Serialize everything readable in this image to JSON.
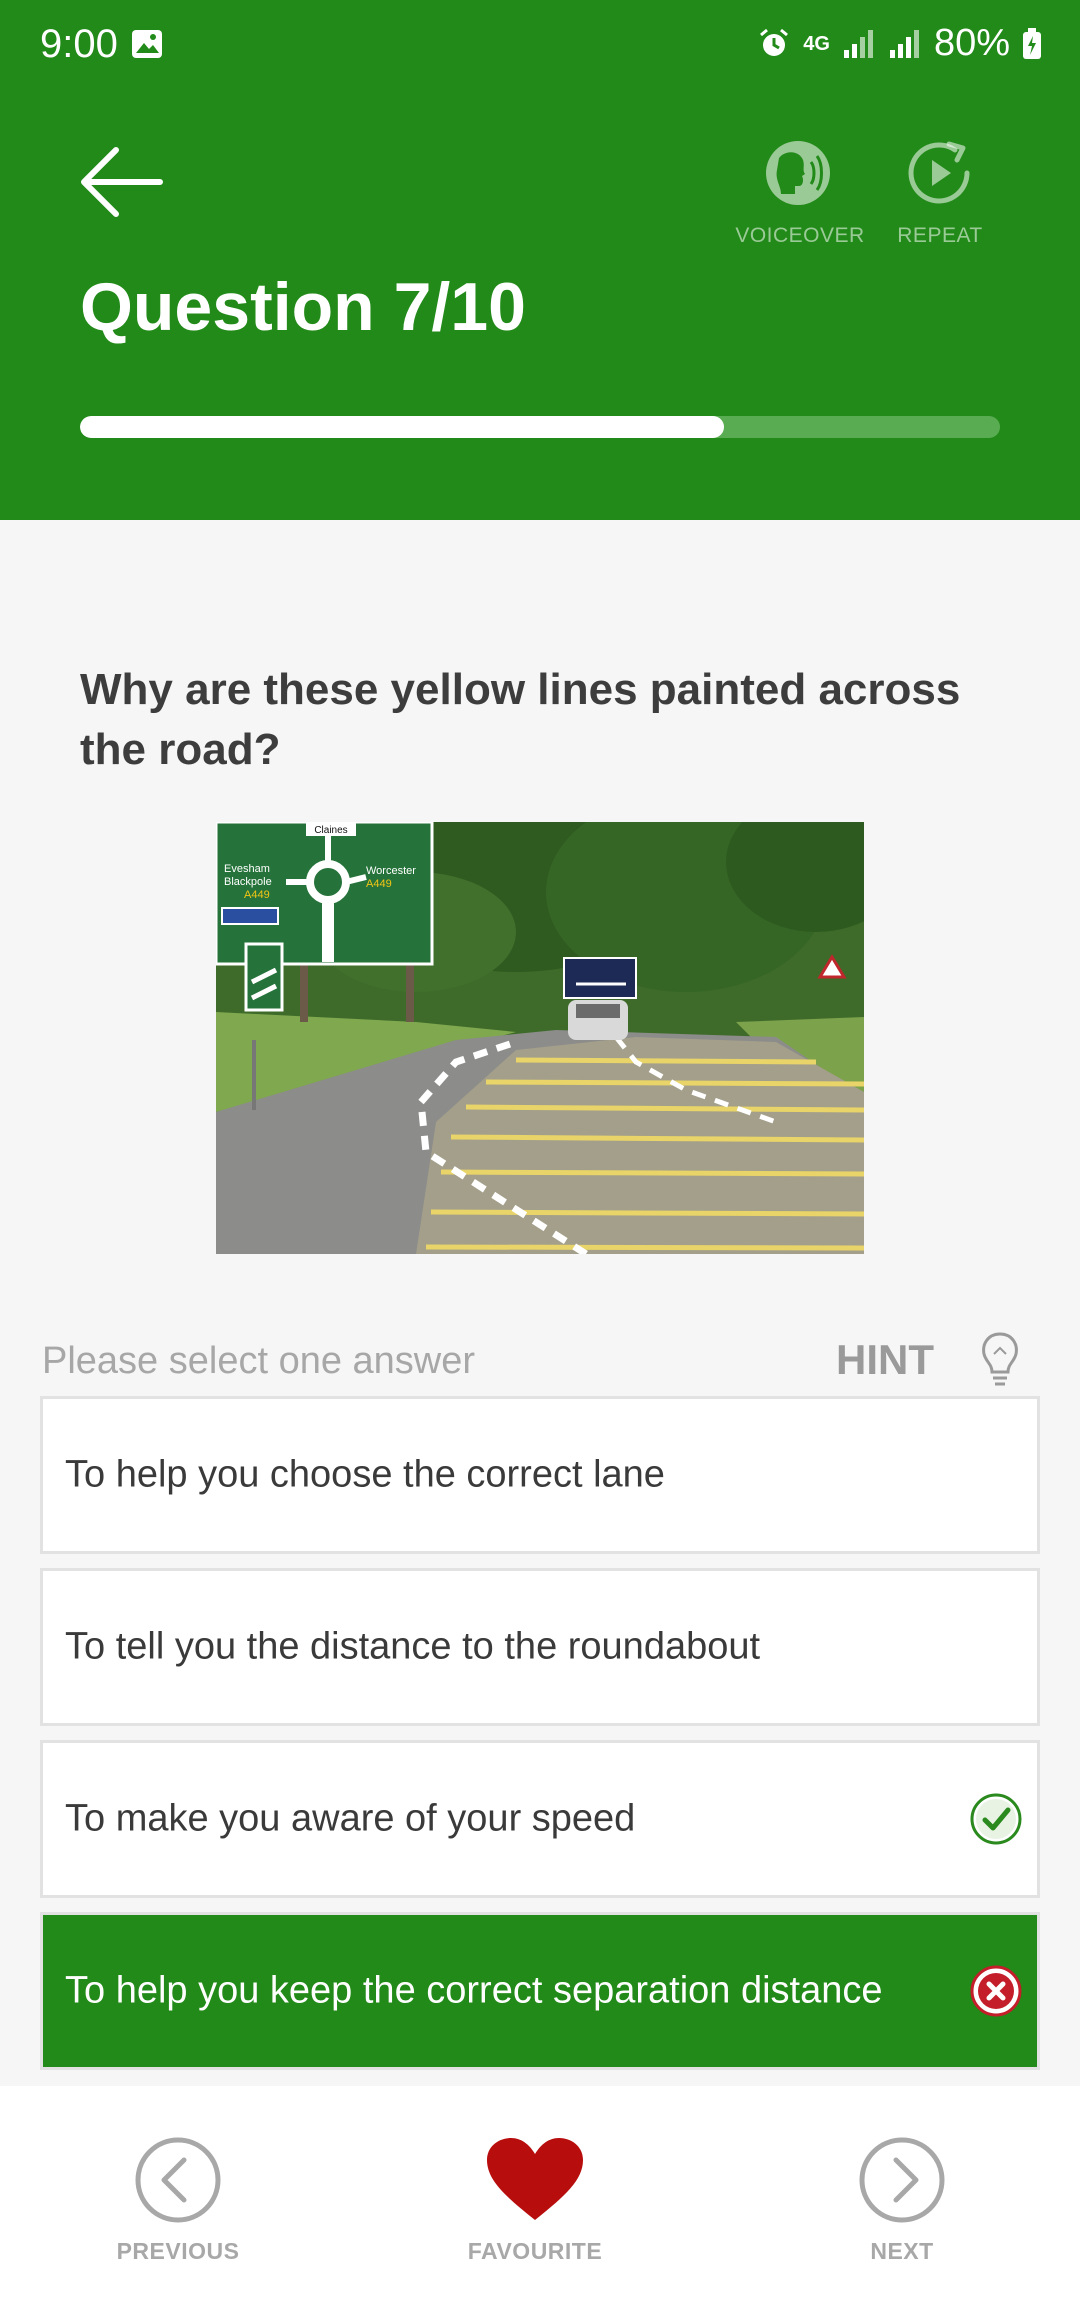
{
  "status_bar": {
    "time": "9:00",
    "network": "4G",
    "battery": "80%"
  },
  "header": {
    "title": "Question 7/10",
    "voiceover_label": "VOICEOVER",
    "repeat_label": "REPEAT",
    "progress_fraction": 0.7
  },
  "question": {
    "text": "Why are these yellow lines painted across the road?",
    "image_sign_text": {
      "top": "Claines",
      "left_1": "Evesham",
      "left_2": "Blackpole",
      "left_3": "A449",
      "right_1": "Worcester",
      "right_2": "A449"
    }
  },
  "answers_section": {
    "instruction": "Please select one answer",
    "hint_label": "HINT",
    "options": [
      {
        "label": "To help you choose the correct lane",
        "state": "none"
      },
      {
        "label": "To tell you the distance to the roundabout",
        "state": "none"
      },
      {
        "label": "To make you aware of your speed",
        "state": "correct"
      },
      {
        "label": "To help you keep the correct separation distance",
        "state": "wrong"
      }
    ]
  },
  "bottom_nav": {
    "previous_label": "PREVIOUS",
    "favourite_label": "FAVOURITE",
    "next_label": "NEXT"
  },
  "colors": {
    "brand_green": "#218a18",
    "favourite_red": "#b80d0d",
    "wrong_red": "#c41e2a",
    "correct_green": "#2a8a1e"
  }
}
